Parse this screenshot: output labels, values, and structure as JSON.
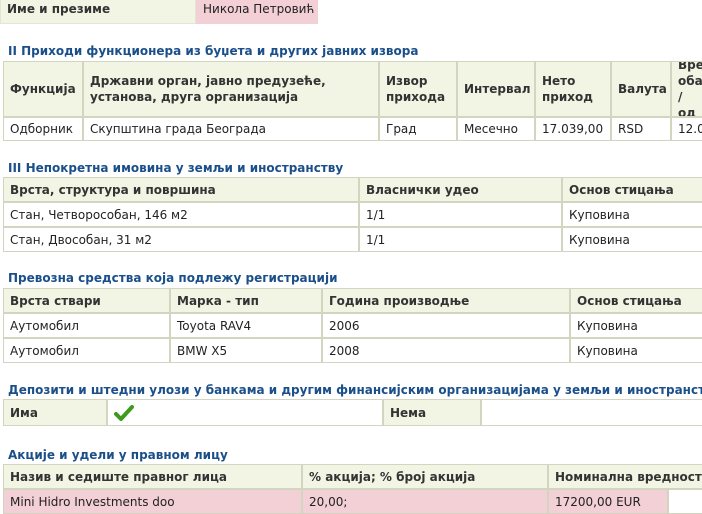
{
  "name_row": {
    "label": "Име и презиме",
    "value": "Никола Петровић"
  },
  "income": {
    "title": "II Приходи функционера из буџета и других јавних извора",
    "headers": [
      "Функција",
      "Државни орган, јавно предузеће, установа, друга организација",
      "Извор прихода",
      "Интервал",
      "Нето приход",
      "Валута",
      "Време обављања / од"
    ],
    "header_display": [
      "Функција",
      "Државни орган, јавно предузеће,\nустанова, друга организација",
      "Извор\nприхода",
      "Интервал",
      "Нето\nприход",
      "Валута",
      "Вре\nоба\n/ од"
    ],
    "rows": [
      [
        "Одборник",
        "Скупштина града Београда",
        "Град",
        "Месечно",
        "17.039,00",
        "RSD",
        "12.0"
      ]
    ]
  },
  "property": {
    "title": "III Непокретна имовина у земљи и иностранству",
    "headers": [
      "Врста, структура и површина",
      "Власнички удео",
      "Основ стицања"
    ],
    "rows": [
      [
        "Стан, Четворособан, 146 м2",
        "1/1",
        "Куповина"
      ],
      [
        "Стан, Двособан, 31 м2",
        "1/1",
        "Куповина"
      ]
    ]
  },
  "vehicles": {
    "title": "Превозна средства која подлежу регистрацији",
    "headers": [
      "Врста ствари",
      "Марка - тип",
      "Година производње",
      "Основ стицања"
    ],
    "rows": [
      [
        "Аутомобил",
        "Toyota RAV4",
        "2006",
        "Куповина"
      ],
      [
        "Аутомобил",
        "BMW X5",
        "2008",
        "Куповина"
      ]
    ]
  },
  "deposits": {
    "title": "Депозити и штедни улози у банкама и другим финансијским организацијама у земљи и иностранству",
    "has_label": "Има",
    "has_icon": "checkmark-icon",
    "none_label": "Нема"
  },
  "shares": {
    "title": "Акције и удели у правном лицу",
    "headers": [
      "Назив и седиште правног лица",
      "% акција; % број акција",
      "Номинална вредност"
    ],
    "rows": [
      [
        "Mini Hidro Investments doo",
        "20,00;",
        "17200,00 EUR"
      ]
    ]
  },
  "colors": {
    "section_title": "#1a4f8a",
    "header_bg": "#f2f4e4",
    "highlight": "#f3cfd6",
    "check": "#3e9b1d"
  }
}
